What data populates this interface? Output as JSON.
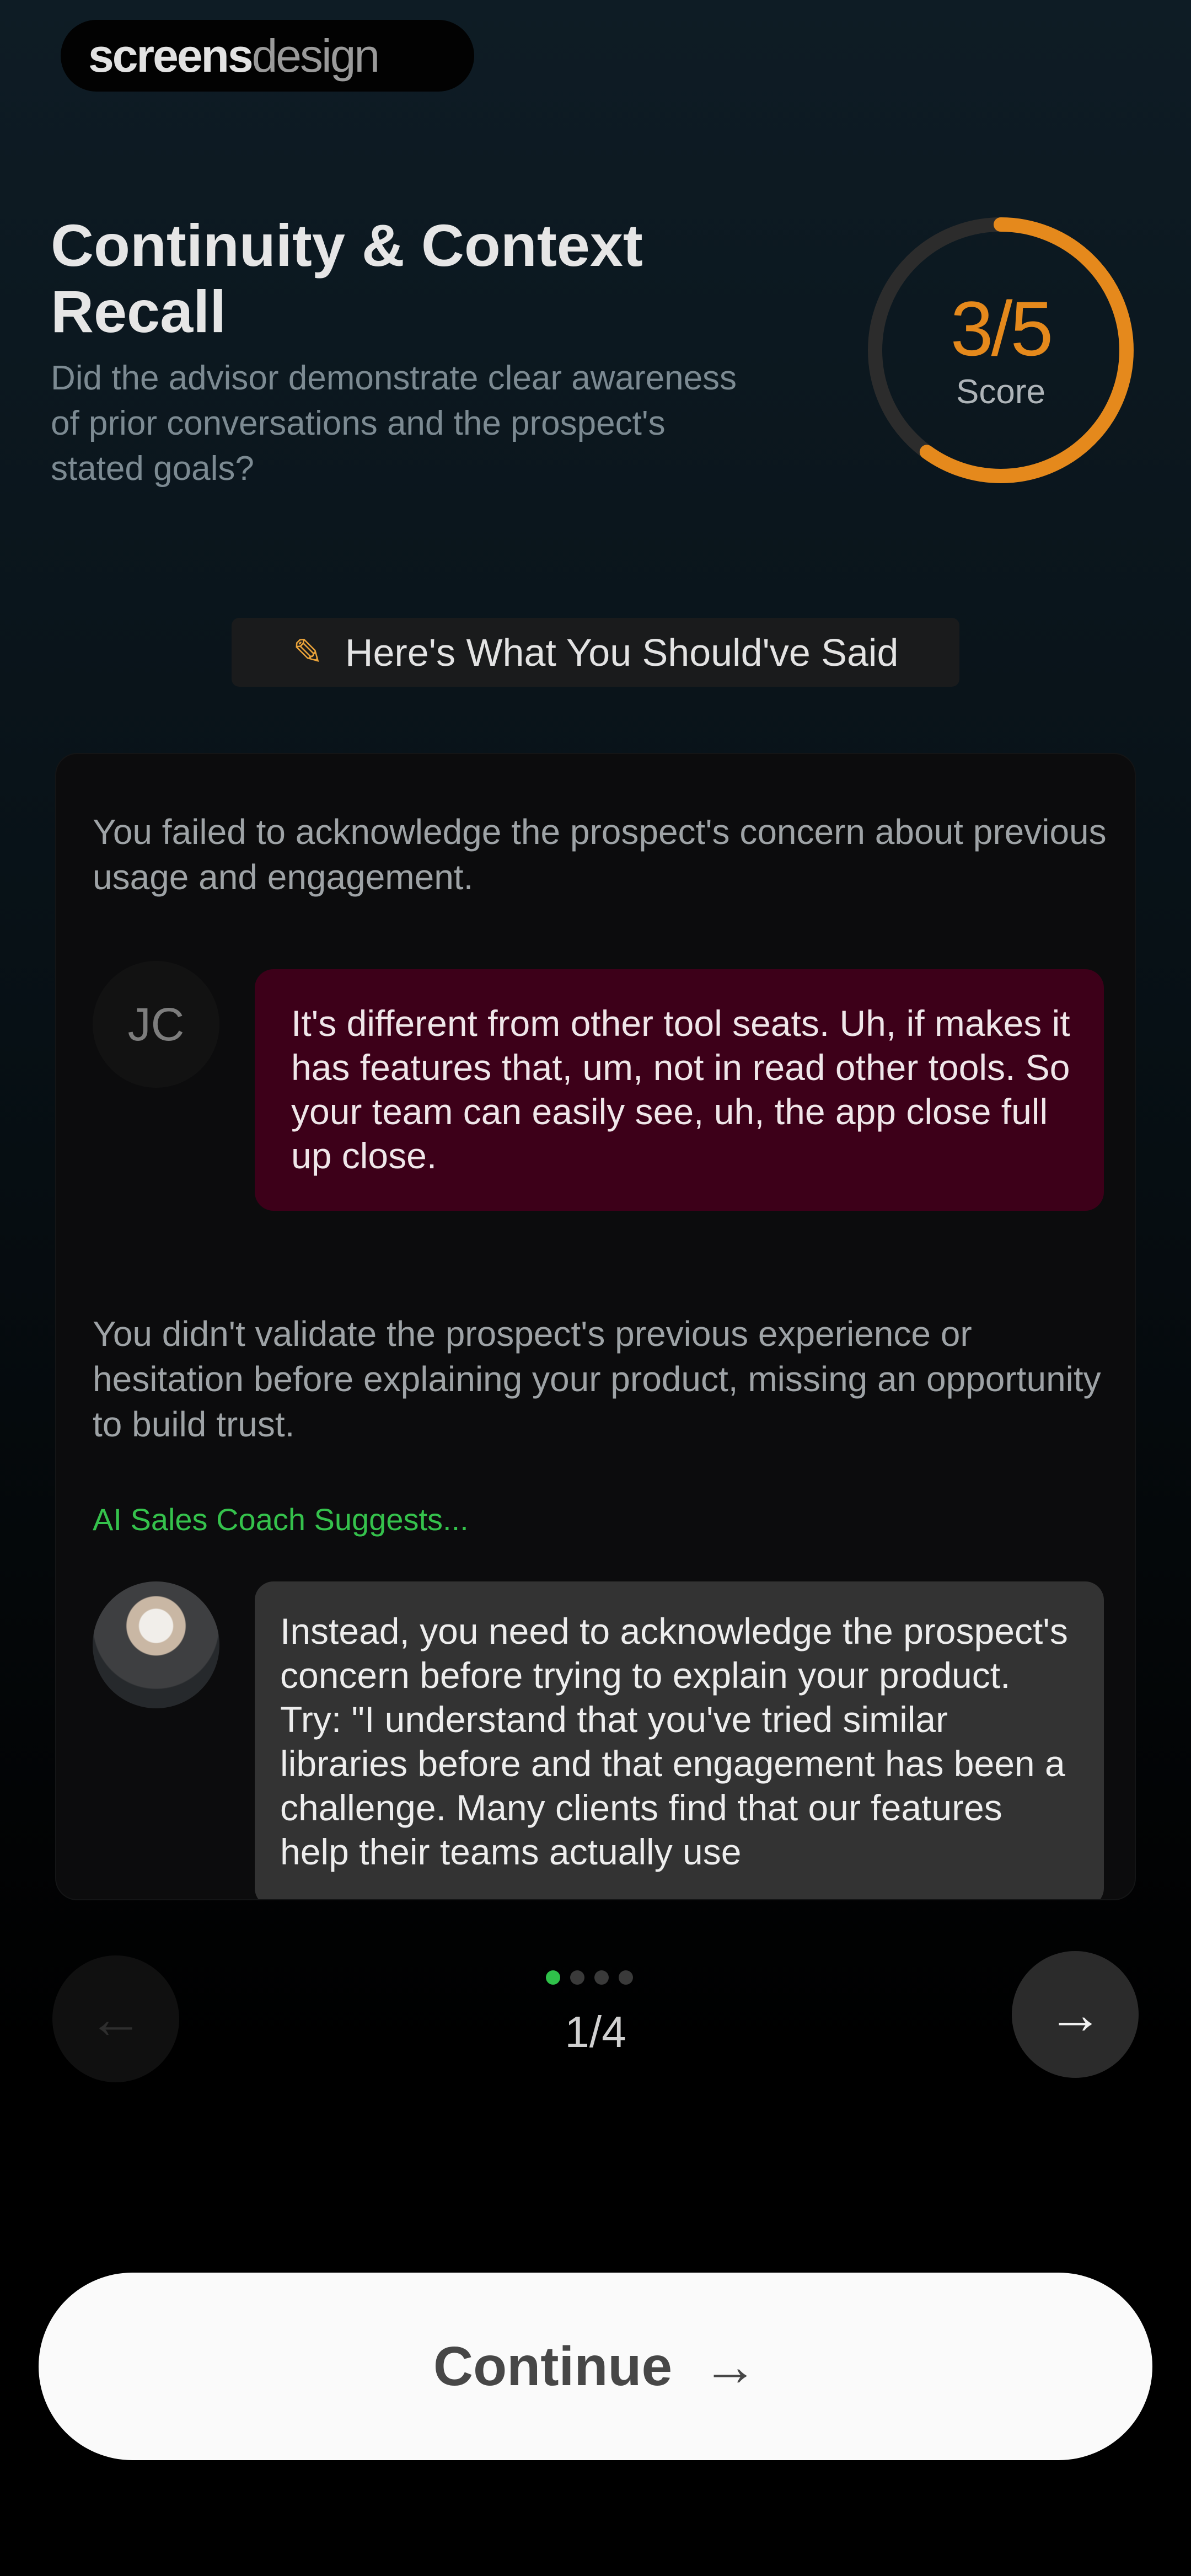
{
  "brand": {
    "part1": "screens",
    "part2": "design"
  },
  "header": {
    "title": "Continuity & Context Recall",
    "subtitle": "Did the advisor demonstrate clear awareness of prior conversations and the prospect's stated goals?"
  },
  "score": {
    "value": "3/5",
    "label": "Score",
    "fraction": 0.6,
    "color": "#e5891c",
    "track_color": "#2c2c2c"
  },
  "section": {
    "icon": "pencil-icon",
    "title": "Here's What You Should've Said"
  },
  "feedback": {
    "note1": "You failed to acknowledge the prospect's concern about previous usage and engagement.",
    "prospect_initials": "JC",
    "prospect_message": "It's different from other tool seats. Uh, if makes it has features that, um, not in read other tools. So your team can easily see, uh, the app close full up close.",
    "note2": "You didn't validate the prospect's previous experience or hesitation before explaining your product, missing an opportunity to build trust.",
    "coach_label": "AI Sales Coach Suggests...",
    "coach_message": "Instead, you need to acknowledge the prospect's concern before trying to explain your product. Try: \"I understand that you've tried similar libraries before and that engagement has been a challenge. Many clients find that our features help their teams actually use"
  },
  "pager": {
    "current": "1/4",
    "prev_arrow": "←",
    "next_arrow": "→"
  },
  "cta": {
    "label": "Continue",
    "arrow": "→"
  }
}
